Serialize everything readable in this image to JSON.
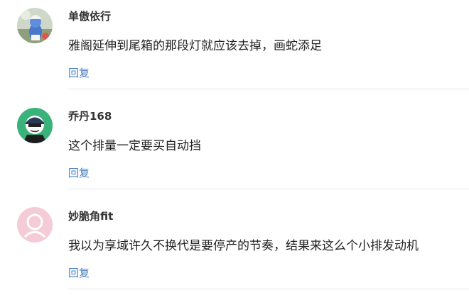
{
  "comments": [
    {
      "username": "单傲依行",
      "text": "雅阁延伸到尾箱的那段灯就应该去掉，画蛇添足",
      "reply": "回复"
    },
    {
      "username": "乔丹168",
      "text": "这个排量一定要买自动挡",
      "reply": "回复"
    },
    {
      "username": "妙脆角fit",
      "text": "我以为享域许久不换代是要停产的节奏，结果来这么个小排发动机",
      "reply": "回复"
    }
  ]
}
